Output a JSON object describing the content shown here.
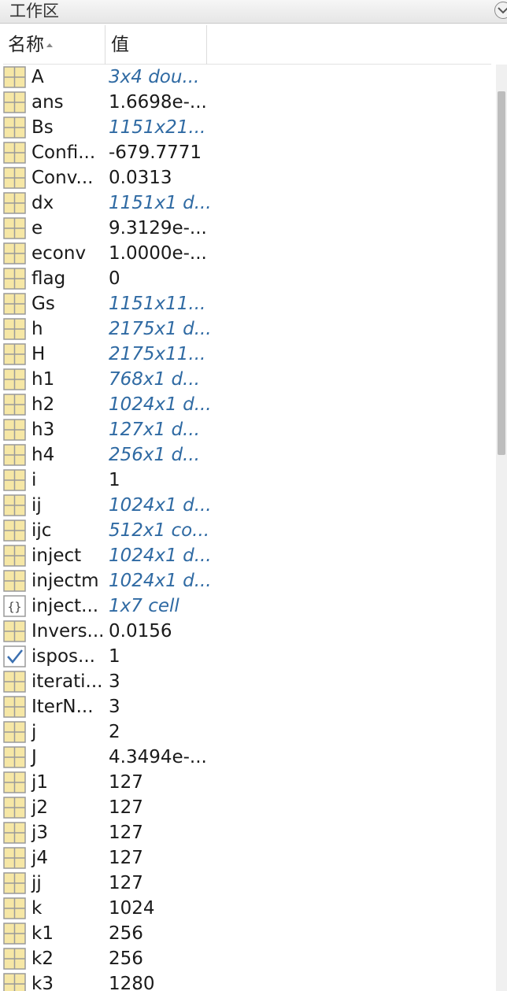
{
  "panel": {
    "title": "工作区"
  },
  "columns": {
    "name": "名称",
    "value": "值"
  },
  "colors": {
    "link_value": "#2f6aa3",
    "icon_fill": "#f6e7a6",
    "icon_border": "#9a9a9a"
  },
  "variables": [
    {
      "name": "A",
      "value": "3x4 dou...",
      "link": true,
      "icon": "matrix-icon"
    },
    {
      "name": "ans",
      "value": "1.6698e-...",
      "link": false,
      "icon": "matrix-icon"
    },
    {
      "name": "Bs",
      "value": "1151x21...",
      "link": true,
      "icon": "matrix-icon"
    },
    {
      "name": "Confi...",
      "value": "-679.7771",
      "link": false,
      "icon": "matrix-icon"
    },
    {
      "name": "Conv...",
      "value": "0.0313",
      "link": false,
      "icon": "matrix-icon"
    },
    {
      "name": "dx",
      "value": "1151x1 d...",
      "link": true,
      "icon": "matrix-icon"
    },
    {
      "name": "e",
      "value": "9.3129e-...",
      "link": false,
      "icon": "matrix-icon"
    },
    {
      "name": "econv",
      "value": "1.0000e-...",
      "link": false,
      "icon": "matrix-icon"
    },
    {
      "name": "flag",
      "value": "0",
      "link": false,
      "icon": "matrix-icon"
    },
    {
      "name": "Gs",
      "value": "1151x11...",
      "link": true,
      "icon": "matrix-icon"
    },
    {
      "name": "h",
      "value": "2175x1 d...",
      "link": true,
      "icon": "matrix-icon"
    },
    {
      "name": "H",
      "value": "2175x11...",
      "link": true,
      "icon": "matrix-icon"
    },
    {
      "name": "h1",
      "value": "768x1 d...",
      "link": true,
      "icon": "matrix-icon"
    },
    {
      "name": "h2",
      "value": "1024x1 d...",
      "link": true,
      "icon": "matrix-icon"
    },
    {
      "name": "h3",
      "value": "127x1 d...",
      "link": true,
      "icon": "matrix-icon"
    },
    {
      "name": "h4",
      "value": "256x1 d...",
      "link": true,
      "icon": "matrix-icon"
    },
    {
      "name": "i",
      "value": "1",
      "link": false,
      "icon": "matrix-icon"
    },
    {
      "name": "ij",
      "value": "1024x1 d...",
      "link": true,
      "icon": "matrix-icon"
    },
    {
      "name": "ijc",
      "value": "512x1 co...",
      "link": true,
      "icon": "matrix-icon"
    },
    {
      "name": "inject",
      "value": "1024x1 d...",
      "link": true,
      "icon": "matrix-icon"
    },
    {
      "name": "injectm",
      "value": "1024x1 d...",
      "link": true,
      "icon": "matrix-icon"
    },
    {
      "name": "inject...",
      "value": "1x7 cell",
      "link": true,
      "icon": "cell-icon"
    },
    {
      "name": "Invers...",
      "value": "0.0156",
      "link": false,
      "icon": "matrix-icon"
    },
    {
      "name": "ispos...",
      "value": "1",
      "link": false,
      "icon": "logical-check-icon"
    },
    {
      "name": "iterati...",
      "value": "3",
      "link": false,
      "icon": "matrix-icon"
    },
    {
      "name": "IterN...",
      "value": "3",
      "link": false,
      "icon": "matrix-icon"
    },
    {
      "name": "j",
      "value": "2",
      "link": false,
      "icon": "matrix-icon"
    },
    {
      "name": "J",
      "value": "4.3494e-...",
      "link": false,
      "icon": "matrix-icon"
    },
    {
      "name": "j1",
      "value": "127",
      "link": false,
      "icon": "matrix-icon"
    },
    {
      "name": "j2",
      "value": "127",
      "link": false,
      "icon": "matrix-icon"
    },
    {
      "name": "j3",
      "value": "127",
      "link": false,
      "icon": "matrix-icon"
    },
    {
      "name": "j4",
      "value": "127",
      "link": false,
      "icon": "matrix-icon"
    },
    {
      "name": "jj",
      "value": "127",
      "link": false,
      "icon": "matrix-icon"
    },
    {
      "name": "k",
      "value": "1024",
      "link": false,
      "icon": "matrix-icon"
    },
    {
      "name": "k1",
      "value": "256",
      "link": false,
      "icon": "matrix-icon"
    },
    {
      "name": "k2",
      "value": "256",
      "link": false,
      "icon": "matrix-icon"
    },
    {
      "name": "k3",
      "value": "1280",
      "link": false,
      "icon": "matrix-icon"
    }
  ]
}
